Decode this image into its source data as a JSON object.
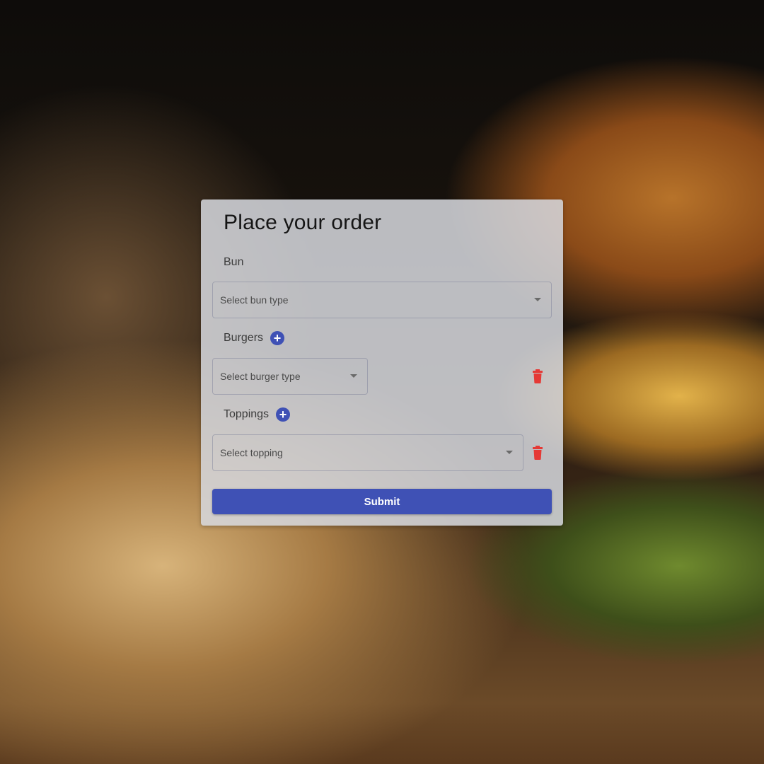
{
  "form": {
    "title": "Place your order",
    "bun": {
      "label": "Bun",
      "select_placeholder": "Select bun type"
    },
    "burgers": {
      "label": "Burgers",
      "add_icon": "plus-circle-icon",
      "select_placeholder": "Select burger type",
      "delete_icon": "trash-icon"
    },
    "toppings": {
      "label": "Toppings",
      "add_icon": "plus-circle-icon",
      "select_placeholder": "Select topping",
      "delete_icon": "trash-icon"
    },
    "submit_label": "Submit"
  },
  "colors": {
    "accent": "#3f51b5",
    "delete": "#e53935",
    "card": "#d6d8de"
  }
}
